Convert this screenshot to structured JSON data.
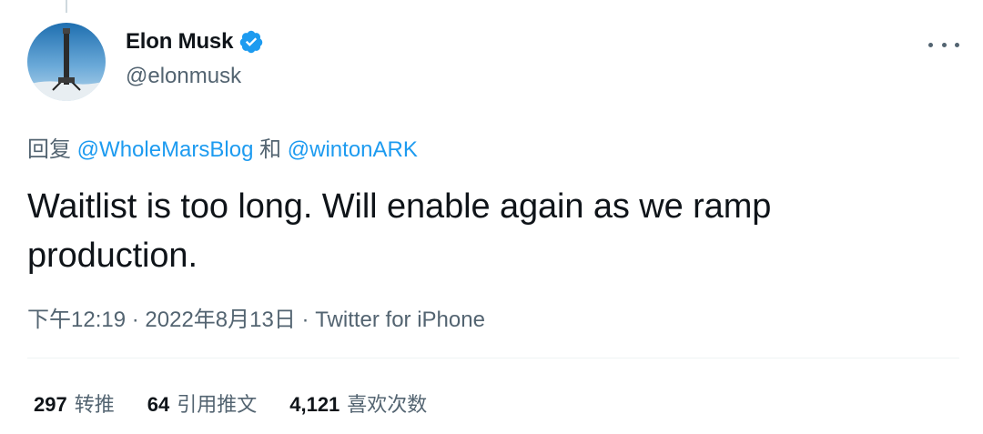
{
  "author": {
    "display_name": "Elon Musk",
    "handle": "@elonmusk",
    "verified": true,
    "verified_color": "#1d9bf0"
  },
  "reply": {
    "prefix": "回复",
    "mention_1": "@WholeMarsBlog",
    "joiner": "和",
    "mention_2": "@wintonARK"
  },
  "tweet": {
    "text": "Waitlist is too long. Will enable again as we ramp production."
  },
  "meta": {
    "time": "下午12:19",
    "separator": "·",
    "date": "2022年8月13日",
    "source": "Twitter for iPhone"
  },
  "stats": {
    "retweets": {
      "count": "297",
      "label": "转推"
    },
    "quotes": {
      "count": "64",
      "label": "引用推文"
    },
    "likes": {
      "count": "4,121",
      "label": "喜欢次数"
    }
  },
  "icons": {
    "verified": "verified-badge-icon",
    "more": "more-options-icon"
  },
  "colors": {
    "link": "#1d9bf0",
    "secondary_text": "#536471",
    "primary_text": "#0f1419"
  }
}
